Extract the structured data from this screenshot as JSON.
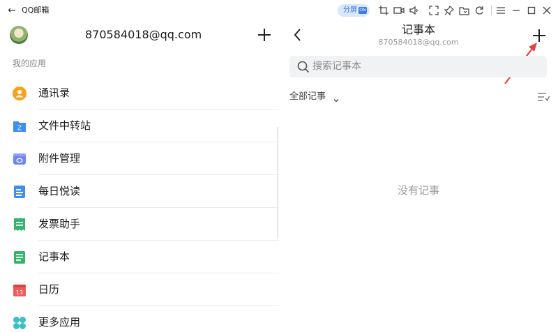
{
  "titlebar": {
    "title": "QQ邮箱",
    "split_badge": "分屏",
    "split_badge_state": "ON",
    "icons": [
      "back-arrow-icon",
      "crop-icon",
      "video-icon",
      "speaker-icon",
      "fullscreen-icon",
      "pin-icon",
      "folder-icon",
      "rotate-icon",
      "menu-icon",
      "minimize-icon",
      "maximize-icon",
      "close-icon"
    ]
  },
  "left_pane": {
    "account": "870584018@qq.com",
    "section_label": "我的应用",
    "apps": [
      {
        "label": "通讯录",
        "icon": "contacts-icon",
        "color": "#f7a21b"
      },
      {
        "label": "文件中转站",
        "icon": "file-transfer-icon",
        "color": "#3d8ef0"
      },
      {
        "label": "附件管理",
        "icon": "attachment-icon",
        "color": "#6e86f5"
      },
      {
        "label": "每日悦读",
        "icon": "daily-reading-icon",
        "color": "#3d8ef0"
      },
      {
        "label": "发票助手",
        "icon": "invoice-icon",
        "color": "#34b36b"
      },
      {
        "label": "记事本",
        "icon": "notebook-icon",
        "color": "#34b36b"
      },
      {
        "label": "日历",
        "icon": "calendar-icon",
        "color": "#f25b5b",
        "badge": "13"
      },
      {
        "label": "更多应用",
        "icon": "more-apps-icon",
        "color": "#3bbfc9"
      }
    ]
  },
  "right_pane": {
    "title": "记事本",
    "subtitle": "870584018@qq.com",
    "search_placeholder": "搜索记事本",
    "filter_label": "全部记事",
    "empty_text": "没有记事"
  },
  "colors": {
    "badge_bg": "#dbe8fb",
    "badge_text": "#2f6ee0",
    "annotation_arrow": "#e0413a",
    "search_bg": "#f1f2f4"
  }
}
